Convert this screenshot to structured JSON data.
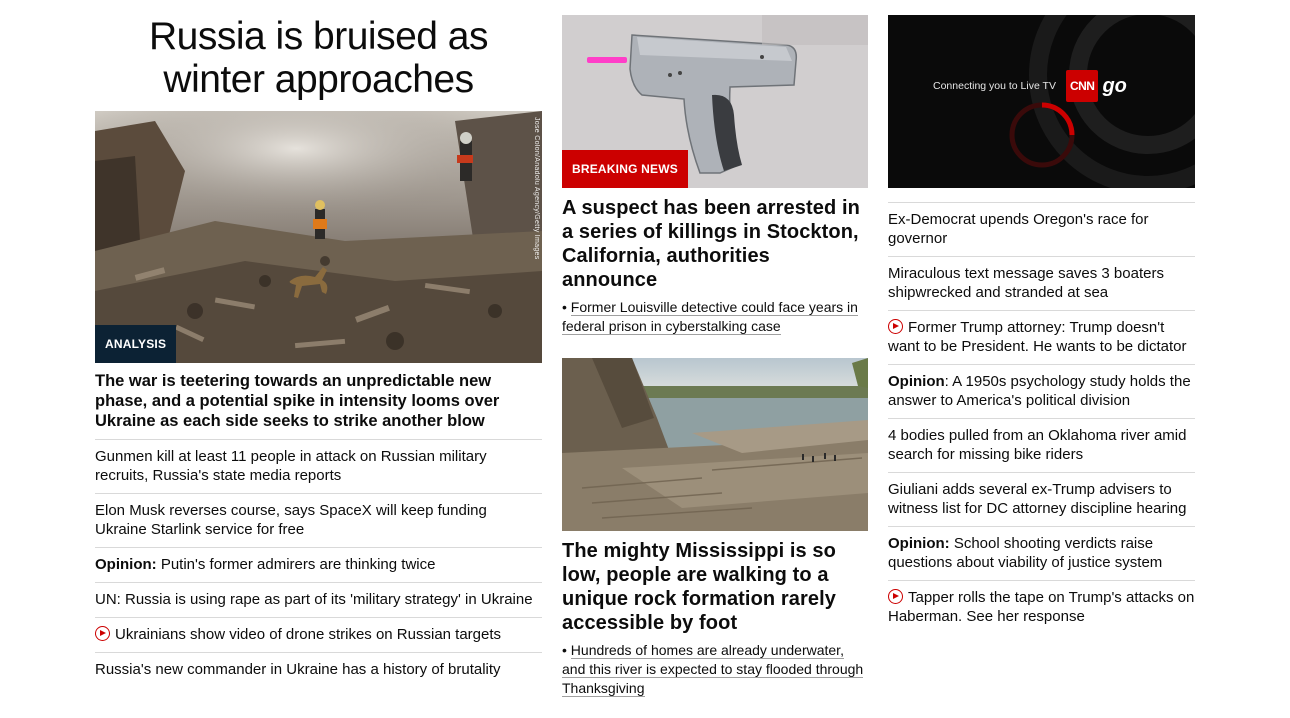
{
  "col1": {
    "title": "Russia is bruised as winter approaches",
    "image_alt": "Rescue worker and dog searching through rubble",
    "image_credit": "Jose Colon/Anadolu Agency/Getty Images",
    "badge": "ANALYSIS",
    "headline": "The war is teetering towards an unpredictable new phase, and a potential spike in intensity looms over Ukraine as each side seeks to strike another blow",
    "items": [
      {
        "prefix": "",
        "text": "Gunmen kill at least 11 people in attack on Russian military recruits, Russia's state media reports",
        "video": false
      },
      {
        "prefix": "",
        "text": "Elon Musk reverses course, says SpaceX will keep funding Ukraine Starlink service for free",
        "video": false
      },
      {
        "prefix": "Opinion:",
        "text": " Putin's former admirers are thinking twice",
        "video": false
      },
      {
        "prefix": "",
        "text": "UN: Russia is using rape as part of its 'military strategy' in Ukraine",
        "video": false
      },
      {
        "prefix": "",
        "text": "Ukrainians show video of drone strikes on Russian targets",
        "video": true
      },
      {
        "prefix": "",
        "text": "Russia's new commander in Ukraine has a history of brutality",
        "video": false
      }
    ]
  },
  "col2": {
    "story1": {
      "badge": "BREAKING NEWS",
      "headline": "A suspect has been arrested in a series of killings in Stockton, California, authorities announce",
      "sub_bullet": "•",
      "sub_link": "Former Louisville detective could face years in federal prison in cyberstalking case"
    },
    "story2": {
      "headline": "The mighty Mississippi is so low, people are walking to a unique rock formation rarely accessible by foot",
      "sub_bullet": "•",
      "sub_link": "Hundreds of homes are already underwater, and this river is expected to stay flooded through Thanksgiving"
    }
  },
  "col3": {
    "live": {
      "text": "Connecting you to Live TV",
      "logo_cnn": "CNN",
      "logo_go": "go"
    },
    "items": [
      {
        "prefix": "",
        "text": "Ex-Democrat upends Oregon's race for governor",
        "video": false
      },
      {
        "prefix": "",
        "text": "Miraculous text message saves 3 boaters shipwrecked and stranded at sea",
        "video": false
      },
      {
        "prefix": "",
        "text": "Former Trump attorney: Trump doesn't want to be President. He wants to be dictator",
        "video": true
      },
      {
        "prefix": "Opinion",
        "text": ": A 1950s psychology study holds the answer to America's political division",
        "video": false
      },
      {
        "prefix": "",
        "text": "4 bodies pulled from an Oklahoma river amid search for missing bike riders",
        "video": false
      },
      {
        "prefix": "",
        "text": "Giuliani adds several ex-Trump advisers to witness list for DC attorney discipline hearing",
        "video": false
      },
      {
        "prefix": "Opinion:",
        "text": " School shooting verdicts raise questions about viability of justice system",
        "video": false
      },
      {
        "prefix": "",
        "text": "Tapper rolls the tape on Trump's attacks on Haberman. See her response",
        "video": true
      }
    ]
  },
  "colors": {
    "breaking": "#cc0000",
    "analysis": "#0c2234",
    "divider": "#d9d9d9"
  }
}
